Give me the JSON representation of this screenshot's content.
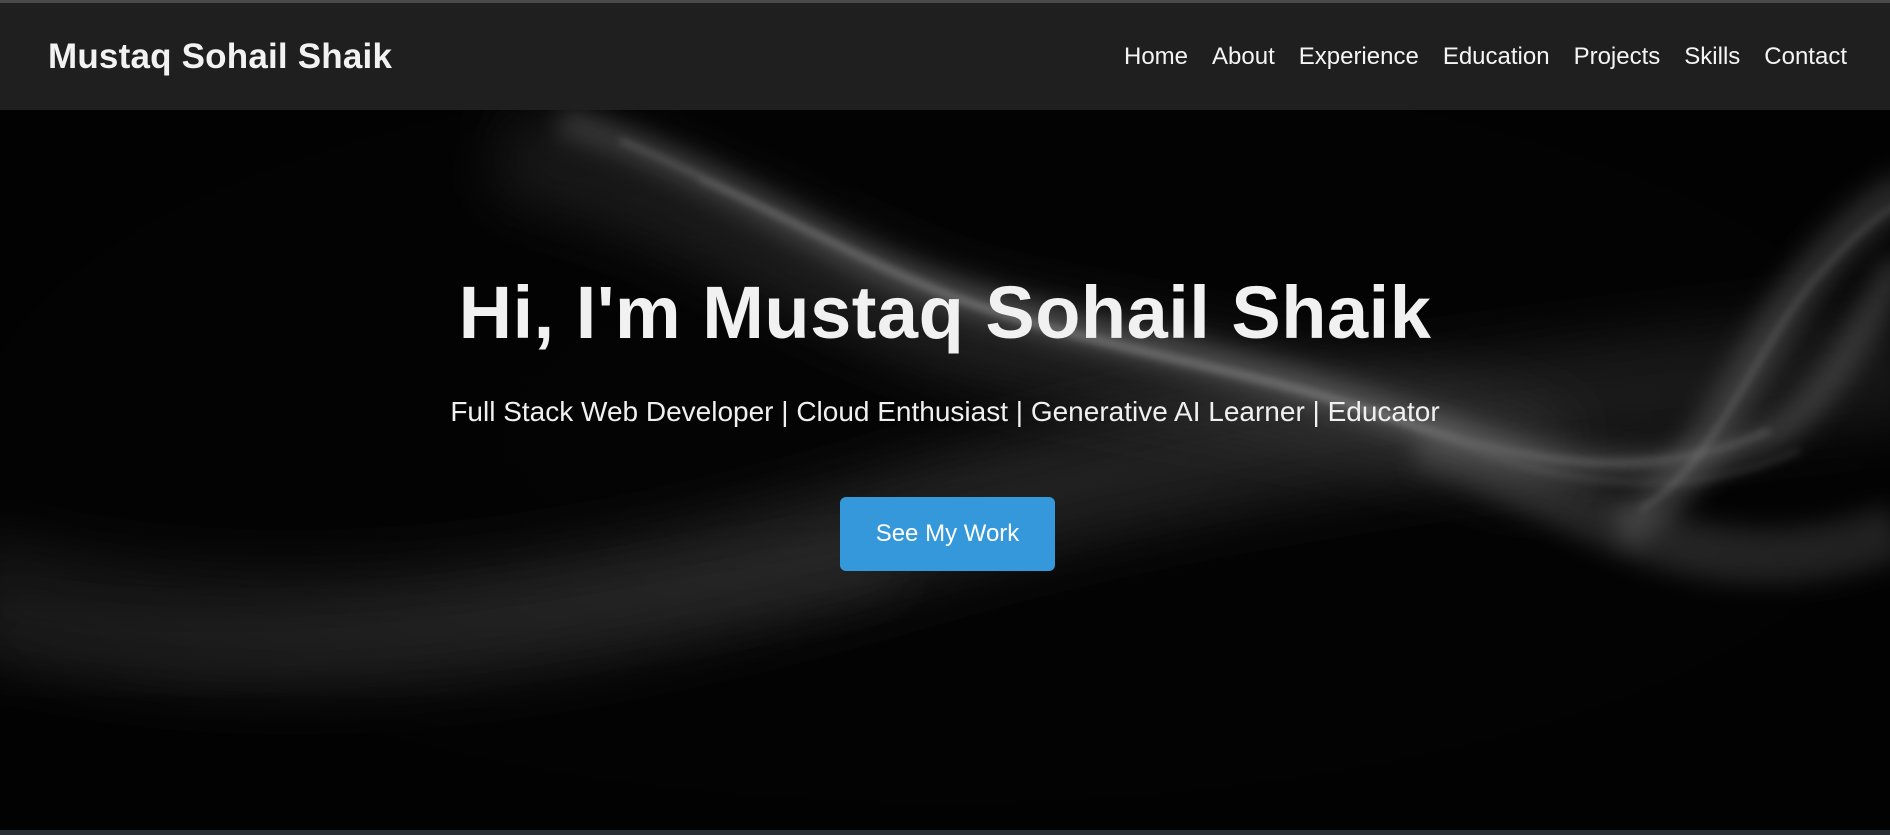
{
  "header": {
    "brand": "Mustaq Sohail Shaik",
    "nav": [
      {
        "label": "Home"
      },
      {
        "label": "About"
      },
      {
        "label": "Experience"
      },
      {
        "label": "Education"
      },
      {
        "label": "Projects"
      },
      {
        "label": "Skills"
      },
      {
        "label": "Contact"
      }
    ]
  },
  "hero": {
    "title": "Hi, I'm Mustaq Sohail Shaik",
    "subtitle": "Full Stack Web Developer | Cloud Enthusiast | Generative AI Learner | Educator",
    "cta_label": "See My Work"
  },
  "colors": {
    "navbar_bg": "#1f1f1f",
    "hero_bg": "#040404",
    "accent": "#3498db",
    "text": "#f1f1f1"
  }
}
